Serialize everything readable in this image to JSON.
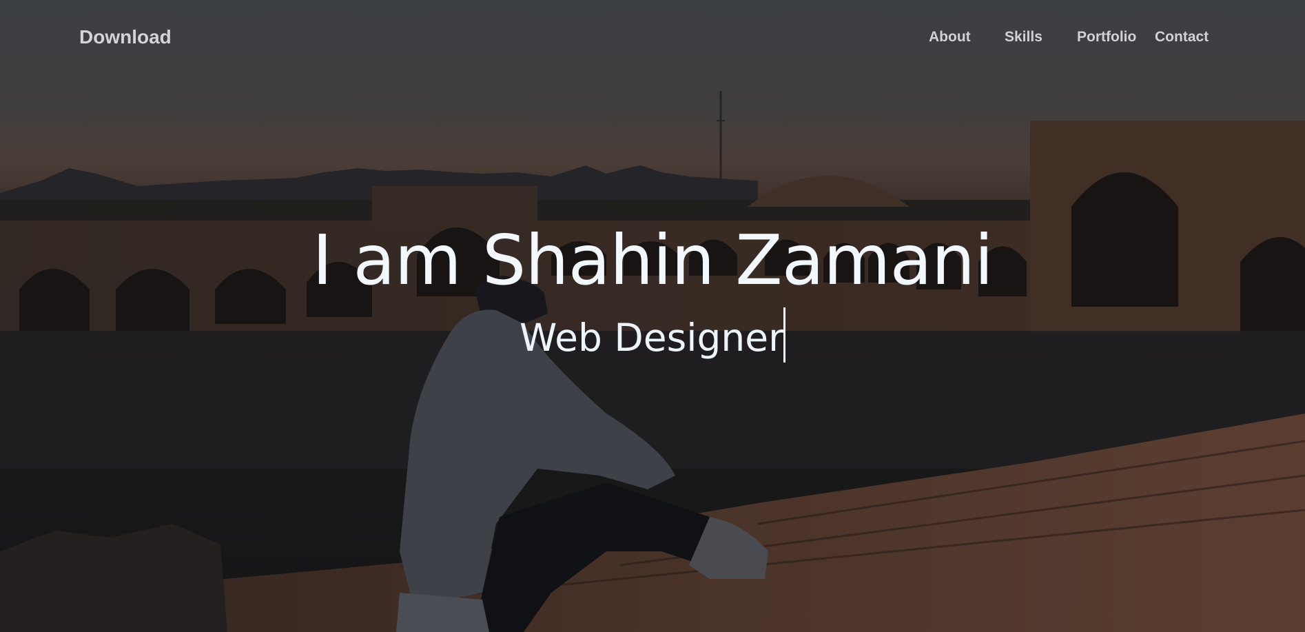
{
  "header": {
    "brand": "Download",
    "nav": [
      {
        "label": "About"
      },
      {
        "label": "Skills"
      },
      {
        "label": "Portfolio"
      },
      {
        "label": "Contact"
      }
    ]
  },
  "hero": {
    "title": "I am Shahin Zamani",
    "subtitle": "Web Designer"
  },
  "colors": {
    "text": "#f3f8ff",
    "nav_text": "#d0d2d6",
    "sky_top": "#4b4f55",
    "ground": "#1b1b1c",
    "brick": "#6b4a3a"
  }
}
